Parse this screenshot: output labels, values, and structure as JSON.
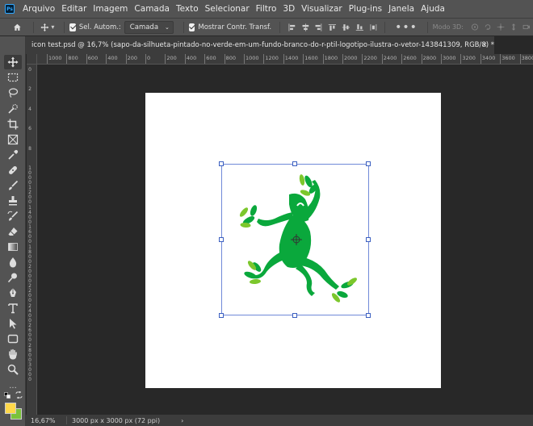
{
  "app": {
    "logo_text": "Ps"
  },
  "menu": [
    "Arquivo",
    "Editar",
    "Imagem",
    "Camada",
    "Texto",
    "Selecionar",
    "Filtro",
    "3D",
    "Visualizar",
    "Plug-ins",
    "Janela",
    "Ajuda"
  ],
  "options": {
    "auto_select_label": "Sel. Autom.:",
    "auto_select_value": "Camada",
    "show_transform_label": "Mostrar Contr. Transf.",
    "more_label": "•••",
    "mode_3d_label": "Modo 3D:"
  },
  "document": {
    "tab_title": "icon test.psd @ 16,7% (sapo-da-silhueta-pintado-no-verde-em-um-fundo-branco-do-r-ptil-logotipo-ilustra-o-vetor-143841309, RGB/8) *",
    "close_label": "×"
  },
  "rulers": {
    "horizontal": [
      "1000",
      "800",
      "600",
      "400",
      "200",
      "0",
      "200",
      "400",
      "600",
      "800",
      "1000",
      "1200",
      "1400",
      "1600",
      "1800",
      "2000",
      "2200",
      "2400",
      "2600",
      "2800",
      "3000",
      "3200",
      "3400",
      "3600",
      "3800"
    ],
    "vertical": [
      "0",
      "2",
      "4",
      "6",
      "8",
      "1000",
      "1200",
      "1400",
      "1600",
      "1800",
      "2000",
      "2200",
      "2400",
      "2600",
      "2800",
      "3000"
    ]
  },
  "colors": {
    "foreground": "#ffd84a",
    "background": "#7bc23b",
    "frog_dark": "#0aa83c",
    "frog_light": "#7cc72c",
    "selection": "#7089d8"
  },
  "status": {
    "zoom": "16,67%",
    "doc_info": "3000 px x 3000 px (72 ppi)",
    "arrow": "›"
  },
  "tools": [
    "move-tool-icon",
    "marquee-tool-icon",
    "lasso-tool-icon",
    "quick-select-tool-icon",
    "crop-tool-icon",
    "frame-tool-icon",
    "eyedropper-tool-icon",
    "healing-brush-icon",
    "brush-tool-icon",
    "stamp-tool-icon",
    "history-brush-icon",
    "eraser-tool-icon",
    "gradient-tool-icon",
    "blur-tool-icon",
    "dodge-tool-icon",
    "pen-tool-icon",
    "type-tool-icon",
    "path-select-tool-icon",
    "rectangle-tool-icon",
    "hand-tool-icon",
    "zoom-tool-icon"
  ]
}
